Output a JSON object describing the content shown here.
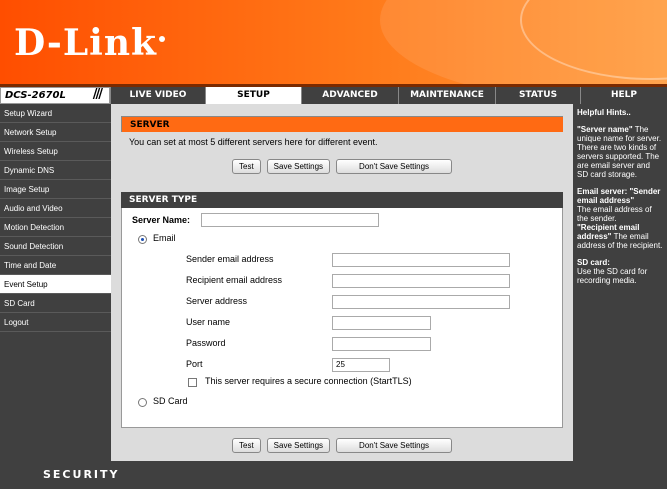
{
  "brand": {
    "logo": "D-Link",
    "model": "DCS-2670L",
    "footer": "SECURITY"
  },
  "nav": {
    "tabs": [
      "LIVE VIDEO",
      "SETUP",
      "ADVANCED",
      "MAINTENANCE",
      "STATUS",
      "HELP"
    ],
    "active": "SETUP"
  },
  "sidebar": {
    "items": [
      "Setup Wizard",
      "Network Setup",
      "Wireless Setup",
      "Dynamic DNS",
      "Image Setup",
      "Audio and Video",
      "Motion Detection",
      "Sound Detection",
      "Time and Date",
      "Event Setup",
      "SD Card",
      "Logout"
    ],
    "active": "Event Setup"
  },
  "server": {
    "title": "SERVER",
    "description": "You can set at most 5 different servers here for different event.",
    "buttons": {
      "test": "Test",
      "save": "Save Settings",
      "dont_save": "Don't Save Settings"
    }
  },
  "server_type": {
    "title": "SERVER TYPE",
    "server_name_label": "Server Name:",
    "server_name_value": "",
    "email_label": "Email",
    "email_selected": true,
    "fields": {
      "sender": "Sender email address",
      "recipient": "Recipient email address",
      "server": "Server address",
      "user": "User name",
      "password": "Password",
      "port": "Port",
      "port_value": "25"
    },
    "secure_label": "This server requires a secure connection (StartTLS)",
    "secure_checked": false,
    "sdcard_label": "SD Card"
  },
  "bottom_buttons": {
    "test": "Test",
    "save": "Save Settings",
    "dont_save": "Don't Save Settings"
  },
  "hints": {
    "title": "Helpful Hints..",
    "p1_bold": "\"Server name\"",
    "p1": " The unique name for server. There are two kinds of servers supported. The are email server and SD card storage.",
    "p2_bold": "Email server: \"Sender email address\"",
    "p2": " The email address of the sender.",
    "p3_bold": "\"Recipient email address\"",
    "p3": " The email address of the recipient.",
    "p4_bold": "SD card:",
    "p4": "Use the SD card for recording media."
  }
}
